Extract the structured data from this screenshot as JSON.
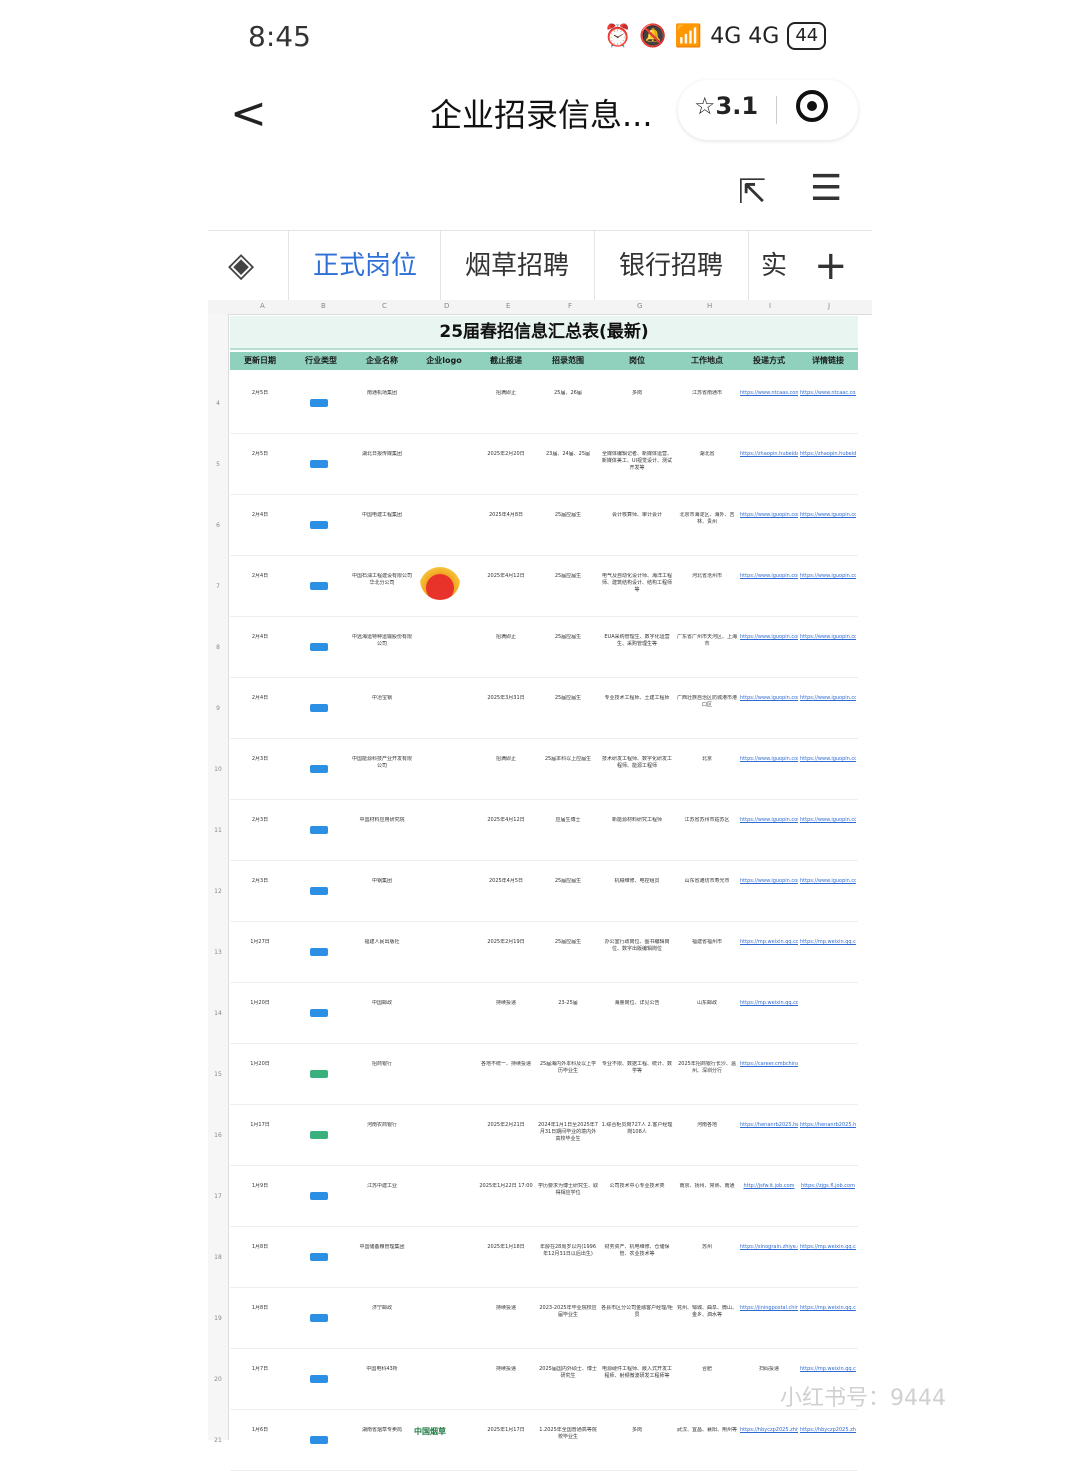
{
  "status": {
    "time": "8:45",
    "signal": "4G 4G",
    "battery": "44"
  },
  "nav": {
    "back": "<",
    "title": "企业招录信息...",
    "rating": "☆3.1"
  },
  "toolbar": {
    "share": "⇱",
    "menu": "☰"
  },
  "tabs": [
    "正式岗位",
    "烟草招聘",
    "银行招聘",
    "实"
  ],
  "sheet": {
    "title": "25届春招信息汇总表(最新)",
    "columns": [
      "更新日期",
      "行业类型",
      "企业名称",
      "企业logo",
      "截止报递",
      "招录范围",
      "岗位",
      "工作地点",
      "投递方式",
      "详情链接"
    ],
    "col_letters": [
      "A",
      "B",
      "C",
      "D",
      "E",
      "F",
      "G",
      "H",
      "I",
      "J"
    ],
    "rows": [
      {
        "n": "4",
        "date": "2月5日",
        "company": "南通机场集团",
        "deadline": "招满即止",
        "scope": "25届、26届",
        "post": "多岗",
        "place": "江苏省南通市",
        "apply": "https://www.ntcaas.com/xiaoxin",
        "detail": "https://www.ntcaac.com/xiaoxin"
      },
      {
        "n": "5",
        "date": "2月5日",
        "company": "湖北日报传媒集团",
        "deadline": "2025年2月20日",
        "scope": "23届、24届、25届",
        "post": "全媒体编辑记者、新媒体运营、新媒体美工、UI视觉设计、测试开发等",
        "place": "湖北省",
        "apply": "https://zhaopin.hubeidaily.net/index",
        "detail": "https://zhaopin.hubeidaily.net/index"
      },
      {
        "n": "6",
        "date": "2月4日",
        "company": "中国电建工程集团",
        "deadline": "2025年4月8日",
        "scope": "25届应届生",
        "post": "会计核算师、审计会计",
        "place": "北京市海淀区、海外、吉林、贵州",
        "apply": "https://www.iguopin.com/job",
        "detail": "https://www.iguopin.com/job"
      },
      {
        "n": "7",
        "date": "2月4日",
        "company": "中国石油工程建设有限公司华北分公司",
        "deadline": "2025年4月12日",
        "scope": "25届应届生",
        "post": "电气及自动化设计师、海洋工程师、建筑结构设计、结构工程师等",
        "place": "河北省沧州市",
        "apply": "https://www.iguopin.com/company",
        "detail": "https://www.iguopin.com/company"
      },
      {
        "n": "8",
        "date": "2月4日",
        "company": "中远海运特种运输股份有限公司",
        "deadline": "招满即止",
        "scope": "25届应届生",
        "post": "EUA采购管理生、数字化运营生、采购管理生等",
        "place": "广东省广州市天河区、上海市",
        "apply": "https://www.iguopin.com/company",
        "detail": "https://www.iguopin.com/company"
      },
      {
        "n": "9",
        "date": "2月4日",
        "company": "中冶宝钢",
        "deadline": "2025年3月31日",
        "scope": "25届应届生",
        "post": "专业技术工程师、土建工程师",
        "place": "广西壮族自治区防城港市港口区",
        "apply": "https://www.iguopin.com/company",
        "detail": "https://www.iguopin.com/company"
      },
      {
        "n": "10",
        "date": "2月3日",
        "company": "中国能源科技产业开发有限公司",
        "deadline": "招满即止",
        "scope": "25届本科以上应届生",
        "post": "技术研发工程师、数字化研发工程师、能源工程师",
        "place": "北京",
        "apply": "https://www.iguopin.com/company",
        "detail": "https://www.iguopin.com/company"
      },
      {
        "n": "11",
        "date": "2月3日",
        "company": "中国材料应用研究院",
        "deadline": "2025年4月12日",
        "scope": "应届生博士",
        "post": "新能源材料研究工程师",
        "place": "江苏省苏州市姑苏区",
        "apply": "https://www.iguopin.com/company",
        "detail": "https://www.iguopin.com/company"
      },
      {
        "n": "12",
        "date": "2月3日",
        "company": "中钢集团",
        "deadline": "2025年4月5日",
        "scope": "25届应届生",
        "post": "机械维修、电控组员",
        "place": "山东省潍坊市寿光市",
        "apply": "https://www.iguopin.com/company",
        "detail": "https://www.iguopin.com/company"
      },
      {
        "n": "13",
        "date": "1月27日",
        "company": "福建人民出版社",
        "deadline": "2025年2月19日",
        "scope": "25届应届生",
        "post": "办公室行政岗位、图书编辑岗位、数字出版编辑岗位",
        "place": "福建省福州市",
        "apply": "https://mp.weixin.qq.com",
        "detail": "https://mp.weixin.qq.com"
      },
      {
        "n": "14",
        "date": "1月20日",
        "company": "中国邮政",
        "deadline": "持续投递",
        "scope": "23-25届",
        "post": "海量岗位、详见公告",
        "place": "山东邮政",
        "apply": "https://mp.weixin.qq.com",
        "detail": ""
      },
      {
        "n": "15",
        "date": "1月20日",
        "company": "招商银行",
        "deadline": "各地不统一、持续投递",
        "scope": "25届海内外本科及以上学历毕业生",
        "post": "专业不限、数据工程、统计、数学等",
        "place": "2025年招商银行长沙、温州、深圳分行",
        "apply": "https://career.cmbchina.com/home",
        "detail": ""
      },
      {
        "n": "16",
        "date": "1月17日",
        "company": "河南农商银行",
        "deadline": "2025年2月21日",
        "scope": "2024年1月1日至2025年7月31日期间毕业的境内外高校毕业生",
        "post": "1.综合柜员岗727人 2.客户经理岗108人",
        "place": "河南各地",
        "apply": "https://henanrb2025.hentongjob.com/",
        "detail": "https://henanrb2025.hentongjob.com/"
      },
      {
        "n": "17",
        "date": "1月9日",
        "company": "江苏中建工业",
        "deadline": "2025年1月22日 17:00",
        "scope": "学历要求为博士研究生、取得相应学位",
        "post": "公司技术中心专业技术类",
        "place": "南京、扬州、常熟、南通",
        "apply": "http://jsfw.it.job.com",
        "detail": "https://zjgs.fl.job.com"
      },
      {
        "n": "18",
        "date": "1月8日",
        "company": "中国储备粮管理集团",
        "deadline": "2025年1月18日",
        "scope": "年龄在28周岁以内(1996年12月31日以后出生)",
        "post": "财务资产、机电维修、仓储保管、农业技术等",
        "place": "苏州",
        "apply": "https://sinograin.zhiye.com",
        "detail": "https://mp.weixin.qq.com"
      },
      {
        "n": "19",
        "date": "1月8日",
        "company": "济宁邮政",
        "deadline": "持续投递",
        "scope": "2023-2025年毕业院校应届毕业生",
        "post": "各县市区分公司金融客户经理/柜员",
        "place": "兖州、邹城、曲阜、微山、金乡、泗水等",
        "apply": "https://jiningpostal.chinapost.com",
        "detail": "https://mp.weixin.qq.com"
      },
      {
        "n": "20",
        "date": "1月7日",
        "company": "中国电科43所",
        "deadline": "持续投递",
        "scope": "2025届国内外硕士、博士研究生",
        "post": "电源硬件工程师、嵌入式开发工程师、射频微波研发工程师等",
        "place": "合肥",
        "apply": "扫码投递",
        "detail": "https://mp.weixin.qq.com"
      },
      {
        "n": "21",
        "date": "1月6日",
        "company": "湖南省烟草专卖局",
        "deadline": "2025年1月17日",
        "scope": "1.2025年全国普通高等院校毕业生",
        "post": "多岗",
        "place": "武汉、宜昌、襄阳、荆州等",
        "apply": "https://hbyczp2025.zhiye.com",
        "detail": "https://hbyczp2025.zhiye.com"
      }
    ],
    "tag_labels": {
      "default": "国企",
      "bank": "银行"
    },
    "logo2_text": "中国烟草"
  },
  "watermark": "小红书号：9444"
}
